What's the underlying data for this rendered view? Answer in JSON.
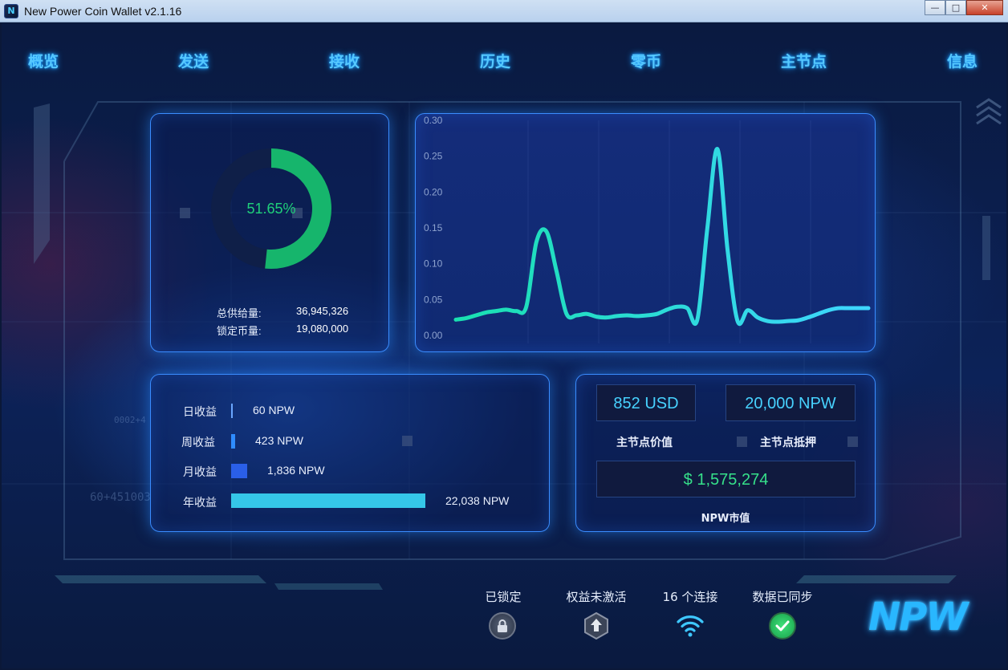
{
  "window": {
    "title": "New Power Coin Wallet v2.1.16",
    "minimize": "—",
    "maximize": "□",
    "close": "✕"
  },
  "nav": {
    "items": [
      {
        "label": "概览"
      },
      {
        "label": "发送"
      },
      {
        "label": "接收"
      },
      {
        "label": "历史"
      },
      {
        "label": "零币"
      },
      {
        "label": "主节点"
      },
      {
        "label": "信息"
      }
    ]
  },
  "supply": {
    "percent_label": "51.65%",
    "percent": 51.65,
    "total_label": "总供给量:",
    "total_value": "36,945,326",
    "locked_label": "锁定币量:",
    "locked_value": "19,080,000"
  },
  "chart_data": {
    "type": "line",
    "yticks": [
      "0.30",
      "0.25",
      "0.20",
      "0.15",
      "0.10",
      "0.05",
      "0.00"
    ],
    "ylim": [
      0,
      0.3
    ],
    "series": [
      {
        "values": [
          0.022,
          0.024,
          0.028,
          0.032,
          0.034,
          0.036,
          0.034,
          0.04,
          0.13,
          0.145,
          0.09,
          0.03,
          0.028,
          0.03,
          0.026,
          0.025,
          0.027,
          0.028,
          0.027,
          0.028,
          0.03,
          0.036,
          0.04,
          0.038,
          0.022,
          0.15,
          0.26,
          0.12,
          0.02,
          0.035,
          0.025,
          0.02,
          0.019,
          0.02,
          0.021,
          0.025,
          0.03,
          0.035,
          0.038,
          0.038,
          0.038,
          0.038
        ]
      }
    ],
    "line_color": "#2de2c8",
    "grid": true
  },
  "earnings": {
    "rows": [
      {
        "label": "日收益",
        "value": "60 NPW",
        "amount": 60,
        "color": "#6aa6ff"
      },
      {
        "label": "周收益",
        "value": "423 NPW",
        "amount": 423,
        "color": "#2f8cff"
      },
      {
        "label": "月收益",
        "value": "1,836 NPW",
        "amount": 1836,
        "color": "#2a5fe8"
      },
      {
        "label": "年收益",
        "value": "22,038 NPW",
        "amount": 22038,
        "color": "#35c7e8"
      }
    ]
  },
  "masternode": {
    "value_usd": "852 USD",
    "value_label": "主节点价值",
    "collateral": "20,000 NPW",
    "collateral_label": "主节点抵押",
    "market_cap": "$ 1,575,274",
    "market_cap_label": "NPW市值"
  },
  "status": {
    "locked": "已锁定",
    "staking": "权益未激活",
    "connections": "16 个连接",
    "synced": "数据已同步"
  },
  "logo": {
    "text": "NPW"
  },
  "colors": {
    "accent": "#55c8ff",
    "donut_green": "#16b56c",
    "value_cyan": "#47d2ff",
    "value_green": "#36e08a"
  }
}
